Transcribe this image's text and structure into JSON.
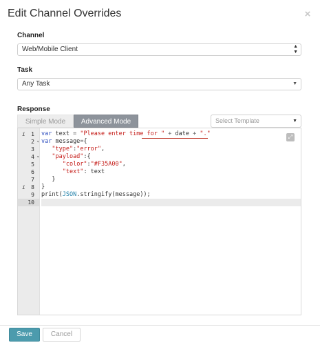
{
  "modal": {
    "title": "Edit Channel Overrides",
    "close_icon": "close-icon"
  },
  "channel": {
    "label": "Channel",
    "selected": "Web/Mobile Client"
  },
  "task": {
    "label": "Task",
    "selected": "Any Task"
  },
  "response": {
    "label": "Response",
    "tabs": [
      {
        "label": "Simple Mode",
        "active": false
      },
      {
        "label": "Advanced Mode",
        "active": true
      }
    ],
    "template_placeholder": "Select Template"
  },
  "editor": {
    "lines": [
      {
        "num": "1",
        "fold": "",
        "marker": "i"
      },
      {
        "num": "2",
        "fold": "▾",
        "marker": ""
      },
      {
        "num": "3",
        "fold": "",
        "marker": ""
      },
      {
        "num": "4",
        "fold": "▾",
        "marker": ""
      },
      {
        "num": "5",
        "fold": "",
        "marker": ""
      },
      {
        "num": "6",
        "fold": "",
        "marker": ""
      },
      {
        "num": "7",
        "fold": "",
        "marker": ""
      },
      {
        "num": "8",
        "fold": "",
        "marker": "i"
      },
      {
        "num": "9",
        "fold": "",
        "marker": ""
      },
      {
        "num": "10",
        "fold": "",
        "marker": ""
      }
    ],
    "code": [
      "var text = \"Please enter time for \" + date + \".\"",
      "var message={",
      "   \"type\":\"error\",",
      "   \"payload\":{",
      "      \"color\":\"#F35A00\",",
      "      \"text\": text",
      "   }",
      "}",
      "print(JSON.stringify(message));",
      ""
    ],
    "fullscreen_icon": "expand-icon"
  },
  "footer": {
    "save_label": "Save",
    "cancel_label": "Cancel"
  }
}
